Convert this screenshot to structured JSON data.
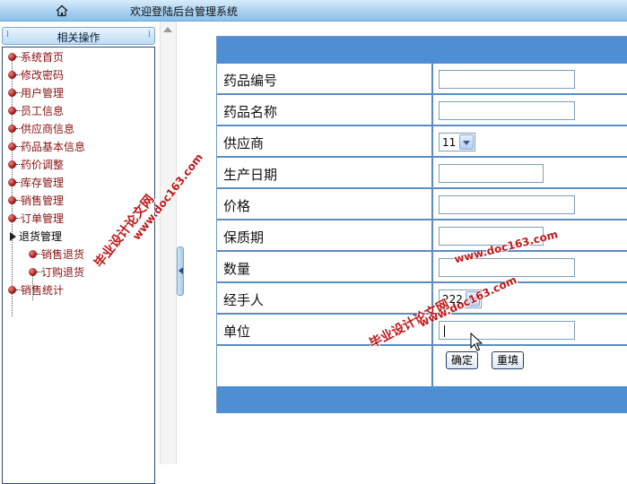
{
  "topbar": {
    "title": "欢迎登陆后台管理系统"
  },
  "sidebar": {
    "header": "相关操作",
    "items": [
      {
        "label": "系统首页"
      },
      {
        "label": "修改密码"
      },
      {
        "label": "用户管理"
      },
      {
        "label": "员工信息"
      },
      {
        "label": "供应商信息"
      },
      {
        "label": "药品基本信息"
      },
      {
        "label": "药价调整"
      },
      {
        "label": "库存管理"
      },
      {
        "label": "销售管理"
      },
      {
        "label": "订单管理"
      },
      {
        "label": "退货管理"
      },
      {
        "label": "销售退货"
      },
      {
        "label": "订购退货"
      },
      {
        "label": "销售统计"
      }
    ]
  },
  "form": {
    "fields": [
      {
        "label": "药品编号",
        "value": ""
      },
      {
        "label": "药品名称",
        "value": ""
      },
      {
        "label": "供应商",
        "value": "11"
      },
      {
        "label": "生产日期",
        "value": ""
      },
      {
        "label": "价格",
        "value": ""
      },
      {
        "label": "保质期",
        "value": ""
      },
      {
        "label": "数量",
        "value": ""
      },
      {
        "label": "经手人",
        "value": "222"
      },
      {
        "label": "单位",
        "value": ""
      }
    ],
    "submit_label": "确定",
    "reset_label": "重填"
  },
  "watermarks": {
    "cn": "毕业设计论文网",
    "url": "www.doc163.com"
  },
  "colors": {
    "band": "#4e8fd3",
    "grid": "#5b8cc2",
    "menu_text": "#8a1010",
    "watermark": "#c0181a"
  }
}
